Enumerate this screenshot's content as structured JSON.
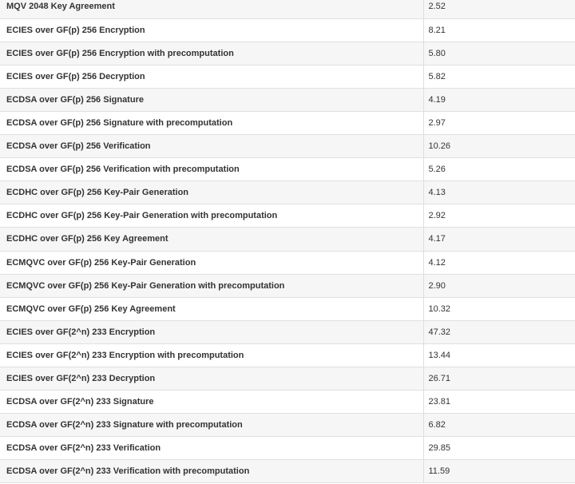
{
  "benchmark_table": {
    "rows": [
      {
        "operation": "MQV 2048 Key Agreement",
        "value": "2.52"
      },
      {
        "operation": "ECIES over GF(p) 256 Encryption",
        "value": "8.21"
      },
      {
        "operation": "ECIES over GF(p) 256 Encryption with precomputation",
        "value": "5.80"
      },
      {
        "operation": "ECIES over GF(p) 256 Decryption",
        "value": "5.82"
      },
      {
        "operation": "ECDSA over GF(p) 256 Signature",
        "value": "4.19"
      },
      {
        "operation": "ECDSA over GF(p) 256 Signature with precomputation",
        "value": "2.97"
      },
      {
        "operation": "ECDSA over GF(p) 256 Verification",
        "value": "10.26"
      },
      {
        "operation": "ECDSA over GF(p) 256 Verification with precomputation",
        "value": "5.26"
      },
      {
        "operation": "ECDHC over GF(p) 256 Key-Pair Generation",
        "value": "4.13"
      },
      {
        "operation": "ECDHC over GF(p) 256 Key-Pair Generation with precomputation",
        "value": "2.92"
      },
      {
        "operation": "ECDHC over GF(p) 256 Key Agreement",
        "value": "4.17"
      },
      {
        "operation": "ECMQVC over GF(p) 256 Key-Pair Generation",
        "value": "4.12"
      },
      {
        "operation": "ECMQVC over GF(p) 256 Key-Pair Generation with precomputation",
        "value": "2.90"
      },
      {
        "operation": "ECMQVC over GF(p) 256 Key Agreement",
        "value": "10.32"
      },
      {
        "operation": "ECIES over GF(2^n) 233 Encryption",
        "value": "47.32"
      },
      {
        "operation": "ECIES over GF(2^n) 233 Encryption with precomputation",
        "value": "13.44"
      },
      {
        "operation": "ECIES over GF(2^n) 233 Decryption",
        "value": "26.71"
      },
      {
        "operation": "ECDSA over GF(2^n) 233 Signature",
        "value": "23.81"
      },
      {
        "operation": "ECDSA over GF(2^n) 233 Signature with precomputation",
        "value": "6.82"
      },
      {
        "operation": "ECDSA over GF(2^n) 233 Verification",
        "value": "29.85"
      },
      {
        "operation": "ECDSA over GF(2^n) 233 Verification with precomputation",
        "value": "11.59"
      }
    ]
  }
}
